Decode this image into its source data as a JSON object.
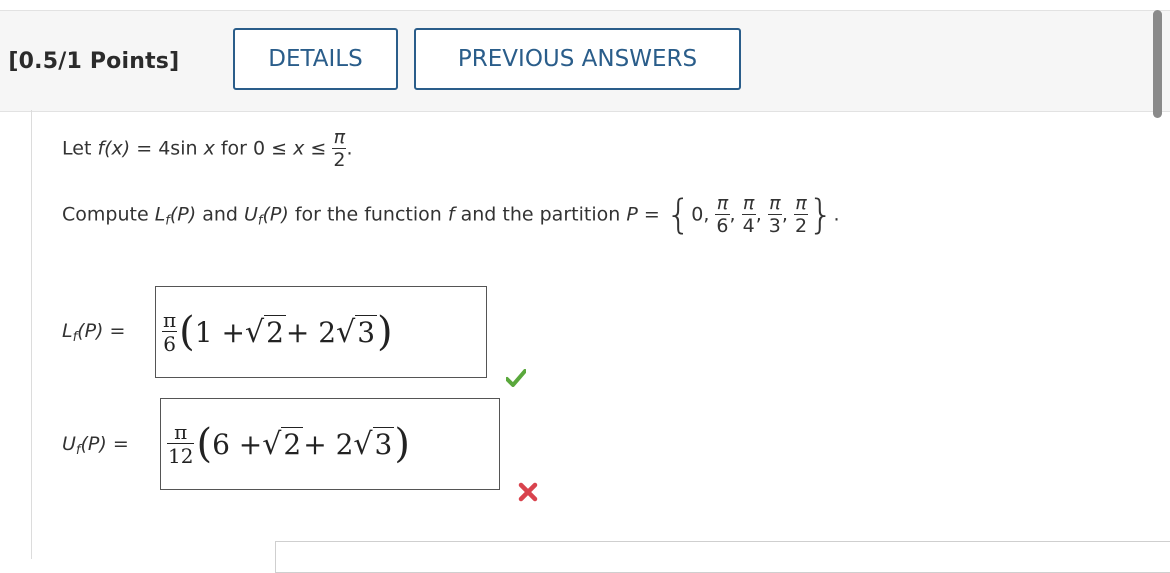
{
  "header": {
    "question_points": ". [0.5/1 Points]",
    "details_label": "DETAILS",
    "previous_answers_label": "PREVIOUS ANSWERS"
  },
  "problem": {
    "line1_prefix": "Let ",
    "line1_fx": "f(x)",
    "line1_eq": " = 4sin ",
    "line1_x": "x",
    "line1_mid": " for 0 ≤ ",
    "line1_x2": "x",
    "line1_le": " ≤ ",
    "pi": "π",
    "two": "2",
    "period": ".",
    "line2_prefix": "Compute ",
    "L": "L",
    "U": "U",
    "f_sub": "f",
    "P": "(P)",
    "and": " and ",
    "line2_mid": " for the function ",
    "f": "f",
    "line2_mid2": " and the partition ",
    "Peq": "P",
    "eq": " = ",
    "set_open": "{",
    "zero": "0,",
    "comma": ",",
    "six": "6",
    "four": "4",
    "three": "3",
    "set_close": "}",
    "final_period": "."
  },
  "answers": {
    "lower_label": "L",
    "lower_eq": " =",
    "lower_coef_num": "π",
    "lower_coef_den": "6",
    "lower_expr_a": "1 + ",
    "lower_expr_b": "2",
    "lower_expr_c": " + 2",
    "lower_expr_d": "3",
    "upper_label": "U",
    "upper_eq": " =",
    "upper_coef_num": "π",
    "upper_coef_den": "12",
    "upper_expr_a": "6 + ",
    "upper_expr_b": "2",
    "upper_expr_c": " + 2",
    "upper_expr_d": "3",
    "lower_status": "correct",
    "upper_status": "incorrect"
  },
  "colors": {
    "accent": "#2a5d8a",
    "correct": "#5aa83c",
    "incorrect": "#d9434e"
  }
}
